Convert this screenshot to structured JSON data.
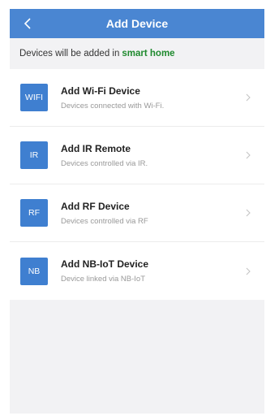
{
  "header": {
    "title": "Add Device",
    "back_icon": "chevron-left-icon"
  },
  "notice": {
    "prefix": "Devices will be added in",
    "home_name": "smart home",
    "home_color": "#1f8a2e"
  },
  "colors": {
    "accent": "#4a86d2",
    "badge": "#3f7fd0"
  },
  "devices": [
    {
      "badge": "WIFI",
      "title": "Add Wi-Fi Device",
      "subtitle": "Devices connected with Wi-Fi."
    },
    {
      "badge": "IR",
      "title": "Add IR Remote",
      "subtitle": "Devices controlled via IR."
    },
    {
      "badge": "RF",
      "title": "Add RF Device",
      "subtitle": "Devices controlled via RF"
    },
    {
      "badge": "NB",
      "title": "Add NB-IoT Device",
      "subtitle": "Device linked via NB-IoT"
    }
  ]
}
